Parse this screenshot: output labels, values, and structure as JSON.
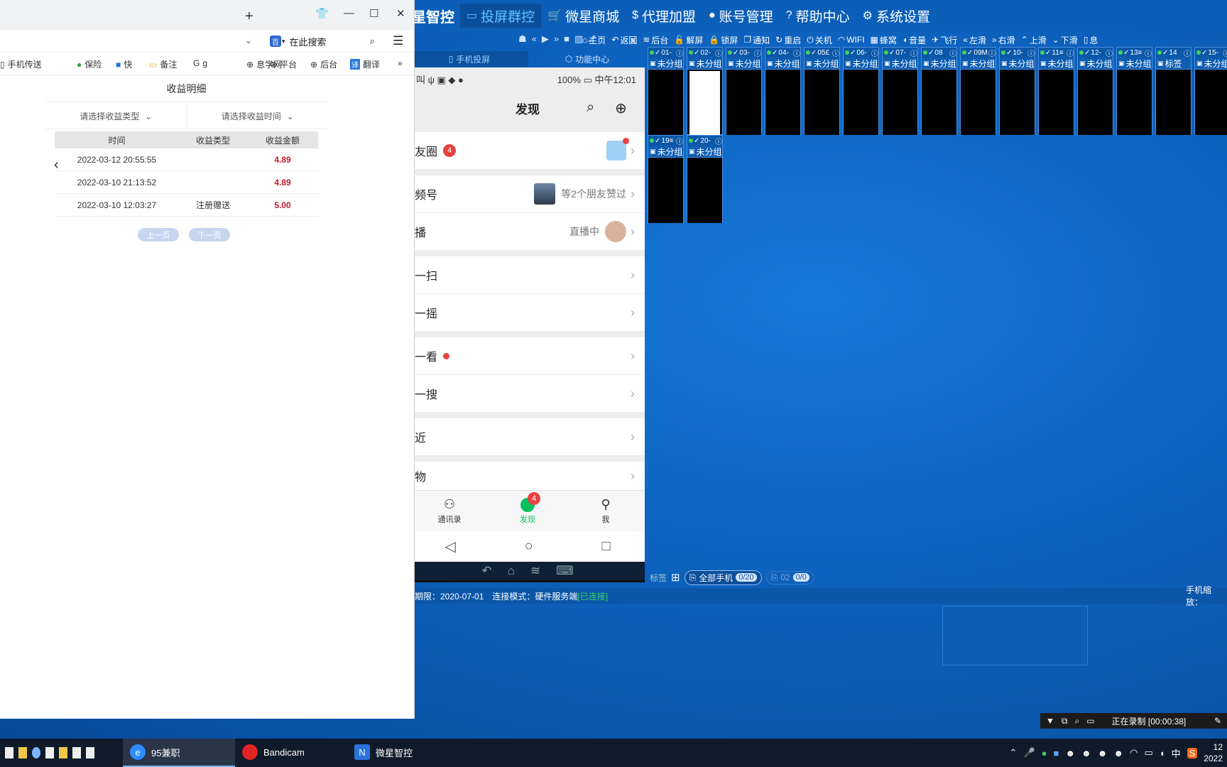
{
  "browser": {
    "search_placeholder": "在此搜索",
    "search_logo": "百",
    "favorites": [
      {
        "label": "手机传送",
        "icon": "doc-icon"
      },
      {
        "label": "保险",
        "icon": "leaf-icon"
      },
      {
        "label": "快",
        "icon": "blue-square-icon"
      },
      {
        "label": "备注",
        "icon": "folder-icon"
      },
      {
        "label": "g",
        "icon": "g-icon"
      },
      {
        "label": "息学网",
        "icon": "globe-icon"
      },
      {
        "label": "平台",
        "icon": "globe-icon"
      },
      {
        "label": "后台",
        "icon": "globe-icon"
      },
      {
        "label": "翻译",
        "icon": "translate-icon"
      }
    ],
    "page": {
      "title": "收益明细",
      "filter_type": "请选择收益类型",
      "filter_time": "请选择收益时间",
      "columns": [
        "时间",
        "收益类型",
        "收益金额"
      ],
      "rows": [
        {
          "time": "2022-03-12 20:55:55",
          "type": "",
          "amount": "4.89"
        },
        {
          "time": "2022-03-10 21:13:52",
          "type": "",
          "amount": "4.89"
        },
        {
          "time": "2022-03-10 12:03:27",
          "type": "注册赠送",
          "amount": "5.00"
        }
      ],
      "prev": "上一页",
      "next": "下一页"
    }
  },
  "app": {
    "brand": "微星智控",
    "nav": [
      {
        "label": "投屏群控",
        "icon": "monitor-icon",
        "active": true
      },
      {
        "label": "微星商城",
        "icon": "cart-icon",
        "active": false
      },
      {
        "label": "代理加盟",
        "icon": "money-bag-icon",
        "active": false
      },
      {
        "label": "账号管理",
        "icon": "user-icon",
        "active": false
      },
      {
        "label": "帮助中心",
        "icon": "help-icon",
        "active": false
      },
      {
        "label": "系统设置",
        "icon": "gear-icon",
        "active": false
      }
    ],
    "toolbar": [
      {
        "label": "主页",
        "icon": "home-icon"
      },
      {
        "label": "返回",
        "icon": "back-icon"
      },
      {
        "label": "后台",
        "icon": "layers-icon"
      },
      {
        "label": "解屏",
        "icon": "unlock-icon"
      },
      {
        "label": "锁屏",
        "icon": "lock-icon"
      },
      {
        "label": "通知",
        "icon": "notify-icon"
      },
      {
        "label": "重启",
        "icon": "restart-icon"
      },
      {
        "label": "关机",
        "icon": "power-icon"
      },
      {
        "label": "WIFI",
        "icon": "wifi-icon"
      },
      {
        "label": "蜂窝",
        "icon": "cellular-icon"
      },
      {
        "label": "音量",
        "icon": "volume-icon"
      },
      {
        "label": "飞行",
        "icon": "plane-icon"
      },
      {
        "label": "左滑",
        "icon": "left-swipe-icon"
      },
      {
        "label": "右滑",
        "icon": "right-swipe-icon"
      },
      {
        "label": "上滑",
        "icon": "up-swipe-icon"
      },
      {
        "label": "下滑",
        "icon": "down-swipe-icon"
      },
      {
        "label": "息",
        "icon": "msg-icon"
      }
    ],
    "tabs": [
      {
        "label": "手机投屏",
        "icon": "phone-icon"
      },
      {
        "label": "功能中心",
        "icon": "cube-icon"
      }
    ],
    "close": "x",
    "devices": [
      {
        "id": "01-",
        "group": "未分组"
      },
      {
        "id": "02-",
        "group": "未分组",
        "shot": true
      },
      {
        "id": "03-",
        "group": "未分组"
      },
      {
        "id": "04-",
        "group": "未分组"
      },
      {
        "id": "05£",
        "group": "未分组"
      },
      {
        "id": "06-",
        "group": "未分组"
      },
      {
        "id": "07-",
        "group": "未分组"
      },
      {
        "id": "08",
        "group": "未分组"
      },
      {
        "id": "09M",
        "group": "未分组"
      },
      {
        "id": "10-",
        "group": "未分组"
      },
      {
        "id": "11≡",
        "group": "未分组"
      },
      {
        "id": "12-",
        "group": "未分组"
      },
      {
        "id": "13≡",
        "group": "未分组"
      },
      {
        "id": "14",
        "group": "标签"
      },
      {
        "id": "15-",
        "group": "未分组"
      },
      {
        "id": "19≡",
        "group": "未分组"
      },
      {
        "id": "20-",
        "group": "未分组"
      }
    ],
    "labelbar": {
      "label": "标签",
      "all": "全部手机",
      "all_count": "0/20",
      "tag": "02",
      "tag_count": "0/0"
    },
    "status": {
      "expiry": "期限：2020-07-01",
      "mode": "连接模式：硬件服务端",
      "conn": "[已连接]",
      "zoom": "手机缩放："
    }
  },
  "phone": {
    "status_left": "叫 ψ ▣ ◆ ●",
    "status_right": "100% ▭ 中午12:01",
    "title": "发现",
    "rows": [
      {
        "label": "友圈",
        "badge": "4",
        "right": "",
        "avatar": "globe"
      },
      {
        "label": "频号",
        "right": "等2个朋友赞过",
        "avatar": "photo"
      },
      {
        "label": "播",
        "right": "直播中",
        "avatar": "face"
      },
      {
        "label": "一扫"
      },
      {
        "label": "一摇"
      },
      {
        "label": "一看",
        "dot": true
      },
      {
        "label": "一搜"
      },
      {
        "label": "近"
      },
      {
        "label": "物"
      }
    ],
    "tabs": [
      {
        "label": "通讯录"
      },
      {
        "label": "发现",
        "badge": "4"
      },
      {
        "label": "我"
      }
    ]
  },
  "recorder": {
    "label": "正在录制 [00:00:38]"
  },
  "taskbar": {
    "apps": [
      {
        "label": "95兼职",
        "active": true
      },
      {
        "label": "Bandicam",
        "active": false
      },
      {
        "label": "微星智控",
        "active": false
      }
    ],
    "ime": "中",
    "clock": "12",
    "date": "2022"
  }
}
